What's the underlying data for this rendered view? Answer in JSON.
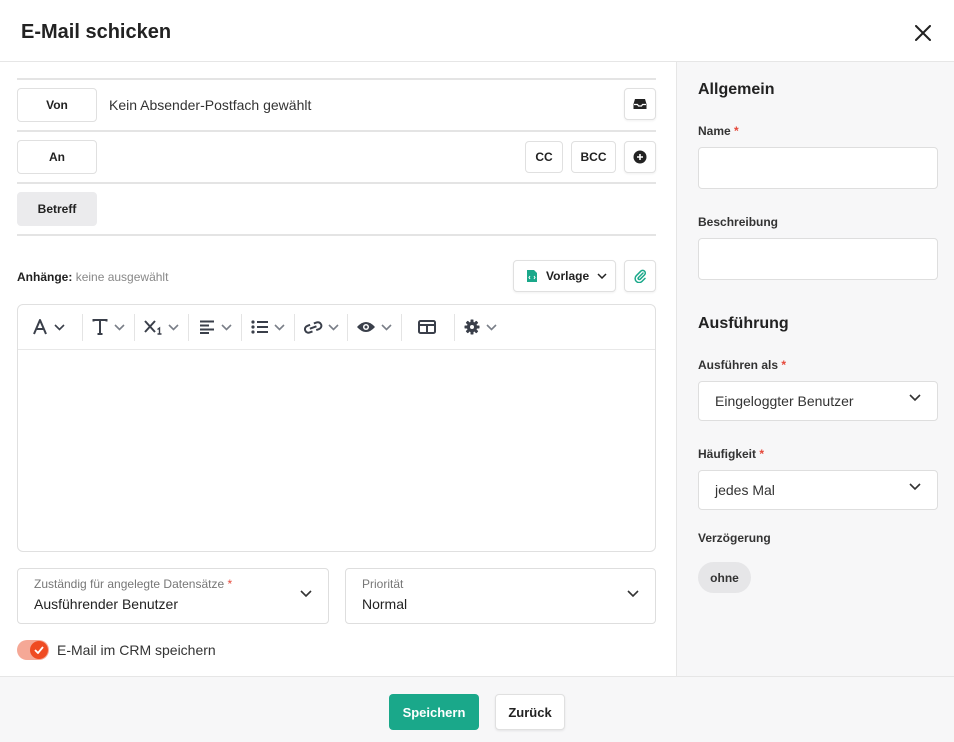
{
  "dialog": {
    "title": "E-Mail schicken"
  },
  "compose": {
    "from_label": "Von",
    "from_value": "Kein Absender-Postfach gewählt",
    "to_label": "An",
    "cc_label": "CC",
    "bcc_label": "BCC",
    "subject_label": "Betreff",
    "attachments_label": "Anhänge:",
    "attachments_value": "keine ausgewählt",
    "template_label": "Vorlage"
  },
  "editor": {
    "toolbar": [
      "font-color",
      "text-style",
      "subscript",
      "align",
      "list",
      "link",
      "preview",
      "table",
      "settings"
    ]
  },
  "bottom": {
    "responsible": {
      "label": "Zuständig für angelegte Datensätze",
      "value": "Ausführender Benutzer"
    },
    "priority": {
      "label": "Priorität",
      "value": "Normal"
    },
    "save_crm_label": "E-Mail im CRM speichern",
    "save_crm_on": true
  },
  "sidebar": {
    "general_heading": "Allgemein",
    "name_label": "Name",
    "description_label": "Beschreibung",
    "execution_heading": "Ausführung",
    "run_as_label": "Ausführen als",
    "run_as_value": "Eingeloggter Benutzer",
    "frequency_label": "Häufigkeit",
    "frequency_value": "jedes Mal",
    "delay_label": "Verzögerung",
    "delay_value": "ohne",
    "required_marker": "*"
  },
  "footer": {
    "save_label": "Speichern",
    "back_label": "Zurück"
  },
  "colors": {
    "accent": "#1aa88a",
    "toggle": "#ef4b22",
    "required": "#e5483a"
  }
}
